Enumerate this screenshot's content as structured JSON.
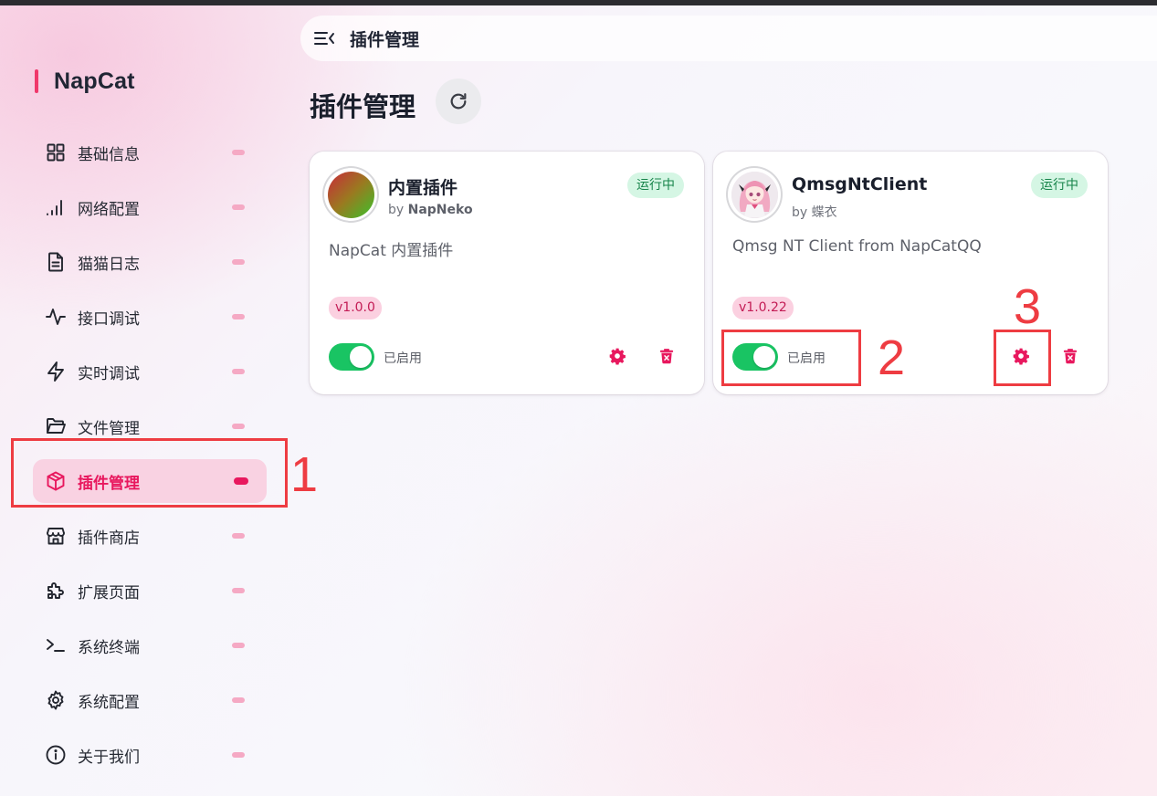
{
  "app": {
    "brand": "NapCat"
  },
  "header": {
    "title": "插件管理"
  },
  "page": {
    "title": "插件管理"
  },
  "sidebar": {
    "items": [
      {
        "label": "基础信息",
        "icon": "dashboard-icon"
      },
      {
        "label": "网络配置",
        "icon": "signal-icon"
      },
      {
        "label": "猫猫日志",
        "icon": "document-icon"
      },
      {
        "label": "接口调试",
        "icon": "activity-icon"
      },
      {
        "label": "实时调试",
        "icon": "lightning-icon"
      },
      {
        "label": "文件管理",
        "icon": "folder-icon"
      },
      {
        "label": "插件管理",
        "icon": "package-icon",
        "active": true
      },
      {
        "label": "插件商店",
        "icon": "store-icon"
      },
      {
        "label": "扩展页面",
        "icon": "puzzle-icon"
      },
      {
        "label": "系统终端",
        "icon": "terminal-icon"
      },
      {
        "label": "系统配置",
        "icon": "gear-icon"
      },
      {
        "label": "关于我们",
        "icon": "info-icon"
      }
    ]
  },
  "plugins": [
    {
      "name": "内置插件",
      "author_prefix": "by ",
      "author": "NapNeko",
      "status": "运行中",
      "description": "NapCat 内置插件",
      "version": "v1.0.0",
      "enabled_label": "已启用",
      "enabled": true
    },
    {
      "name": "QmsgNtClient",
      "author_prefix": "by ",
      "author": "蝶衣",
      "status": "运行中",
      "description": "Qmsg NT Client from NapCatQQ",
      "version": "v1.0.22",
      "enabled_label": "已启用",
      "enabled": true
    }
  ],
  "annotations": [
    "1",
    "2",
    "3"
  ],
  "colors": {
    "accent": "#e8185e",
    "running_bg": "#d5f6e4",
    "running_text": "#17844a",
    "toggle_on": "#19c463",
    "annotation": "#ee3c42"
  }
}
